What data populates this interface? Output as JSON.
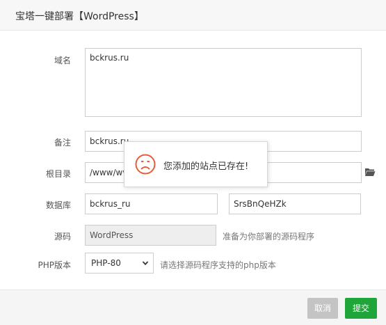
{
  "dialog": {
    "title": "宝塔一键部署【WordPress】"
  },
  "form": {
    "domain": {
      "label": "域名",
      "value": "bckrus.ru"
    },
    "note": {
      "label": "备注",
      "value": "bckrus.ru"
    },
    "root": {
      "label": "根目录",
      "value": "/www/wwwroot/bckrus.ru"
    },
    "database": {
      "label": "数据库",
      "name_value": "bckrus_ru",
      "password_value": "SrsBnQeHZk"
    },
    "source": {
      "label": "源码",
      "value": "WordPress",
      "hint": "准备为你部署的源码程序"
    },
    "php": {
      "label": "PHP版本",
      "selected": "PHP-80",
      "hint": "请选择源码程序支持的php版本"
    }
  },
  "buttons": {
    "cancel": "取消",
    "submit": "提交"
  },
  "toast": {
    "message": "您添加的站点已存在!",
    "icon": "sad-face-icon"
  },
  "colors": {
    "accent": "#20a53a",
    "error_icon": "#e85d3a",
    "cancel": "#c4c4c4"
  },
  "icons": {
    "folder": "folder-open-icon",
    "dropdown": "chevron-down-icon"
  }
}
